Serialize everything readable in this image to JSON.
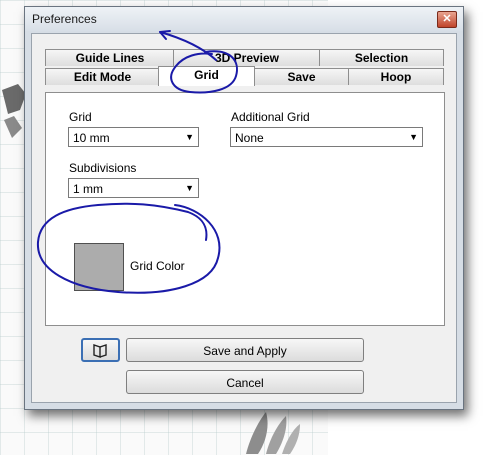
{
  "window": {
    "title": "Preferences",
    "close_glyph": "✕"
  },
  "tabs": {
    "row_back": [
      "Guide Lines",
      "3D Preview",
      "Selection"
    ],
    "row_front": [
      "Edit Mode",
      "Grid",
      "Save",
      "Hoop"
    ],
    "active": "Grid"
  },
  "grid_tab": {
    "grid_label": "Grid",
    "grid_value": "10 mm",
    "additional_grid_label": "Additional Grid",
    "additional_grid_value": "None",
    "subdivisions_label": "Subdivisions",
    "subdivisions_value": "1 mm",
    "grid_color_label": "Grid Color",
    "grid_color": "#acacac"
  },
  "buttons": {
    "help_icon": "book-icon",
    "save_apply": "Save and Apply",
    "cancel": "Cancel"
  },
  "colors": {
    "annotation": "#1a1aa8",
    "dialog_frame": "#d6dde5"
  }
}
